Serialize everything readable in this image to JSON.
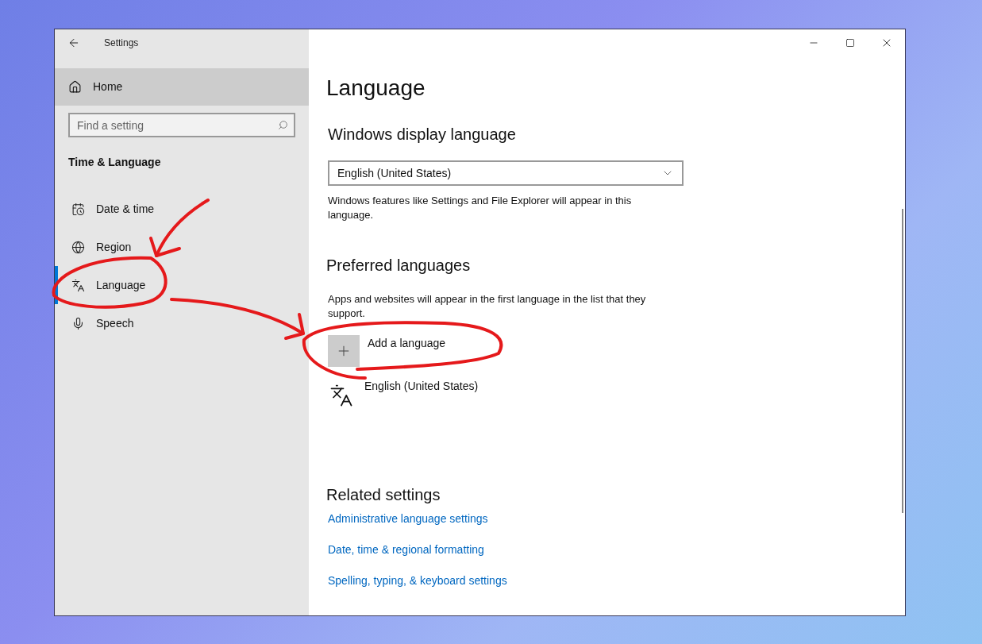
{
  "window": {
    "title": "Settings"
  },
  "sidebar": {
    "home": "Home",
    "search": {
      "placeholder": "Find a setting"
    },
    "section_title": "Time & Language",
    "items": [
      {
        "label": "Date & time",
        "kind": "clock",
        "selected": false
      },
      {
        "label": "Region",
        "kind": "globe",
        "selected": false
      },
      {
        "label": "Language",
        "kind": "language",
        "selected": true
      },
      {
        "label": "Speech",
        "kind": "mic",
        "selected": false
      }
    ]
  },
  "page": {
    "title": "Language",
    "display_language": {
      "heading": "Windows display language",
      "dropdown_value": "English (United States)",
      "note": "Windows features like Settings and File Explorer will appear in this language."
    },
    "preferred": {
      "heading": "Preferred languages",
      "note": "Apps and websites will appear in the first language in the list that they support.",
      "add_button": "Add a language",
      "languages": [
        "English (United States)"
      ]
    },
    "related": {
      "heading": "Related settings",
      "links": [
        "Administrative language settings",
        "Date, time & regional formatting",
        "Spelling, typing, & keyboard settings"
      ]
    }
  }
}
